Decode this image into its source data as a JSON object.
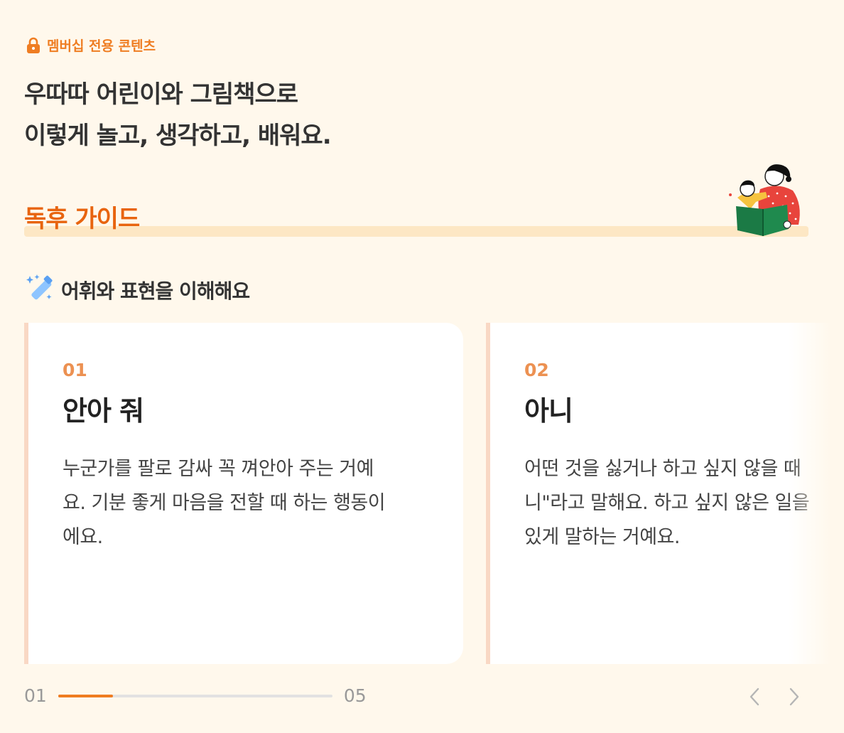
{
  "badge": {
    "label": "멤버십 전용 콘텐츠",
    "icon": "lock-icon",
    "color": "#ef7d22"
  },
  "headline": {
    "line1": "우따따 어린이와 그림책으로",
    "line2": "이렇게 놀고, 생각하고, 배워요."
  },
  "guide": {
    "title": "독후 가이드",
    "title_color": "#e8640f",
    "illustration": "parent-reading-book-illustration"
  },
  "section": {
    "title": "어휘와 표현을 이해해요",
    "icon": "magic-wand-icon"
  },
  "cards": [
    {
      "num": "01",
      "word": "안아 줘",
      "desc_lines": [
        "누군가를 팔로 감싸 꼭 껴안아 주는 거예",
        "요. 기분 좋게 마음을 전할 때 하는 행동이",
        "에요."
      ]
    },
    {
      "num": "02",
      "word": "아니",
      "desc_lines": [
        "어떤 것을 싫거나 하고 싶지 않을 때",
        "니\"라고 말해요. 하고 싶지 않은 일을",
        "있게 말하는 거예요."
      ]
    }
  ],
  "pager": {
    "current": "01",
    "total": "05",
    "progress": 0.2,
    "prev_icon": "chevron-left-icon",
    "next_icon": "chevron-right-icon"
  }
}
